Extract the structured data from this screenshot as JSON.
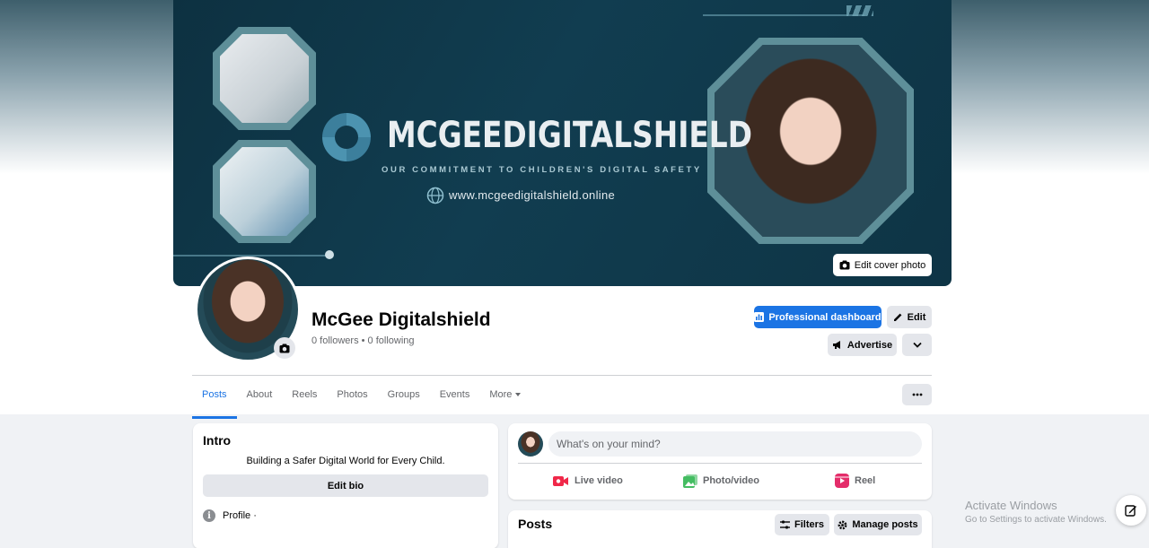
{
  "cover": {
    "brand_name": "MCGEEDIGITALSHIELD",
    "tagline": "OUR COMMITMENT TO CHILDREN'S DIGITAL SAFETY",
    "website": "www.mcgeedigitalshield.online",
    "edit_cover_label": "Edit cover photo"
  },
  "profile": {
    "name": "McGee Digitalshield",
    "followers_line": "0 followers • 0 following"
  },
  "actions": {
    "professional_dashboard": "Professional dashboard",
    "edit": "Edit",
    "advertise": "Advertise"
  },
  "tabs": [
    "Posts",
    "About",
    "Reels",
    "Photos",
    "Groups",
    "Events",
    "More"
  ],
  "intro": {
    "title": "Intro",
    "bio": "Building a Safer Digital World for Every Child.",
    "edit_bio": "Edit bio",
    "profile_label": "Profile ·"
  },
  "composer": {
    "placeholder": "What's on your mind?",
    "live_video": "Live video",
    "photo_video": "Photo/video",
    "reel": "Reel"
  },
  "posts": {
    "title": "Posts",
    "filters": "Filters",
    "manage_posts": "Manage posts"
  },
  "watermark": {
    "line1": "Activate Windows",
    "line2": "Go to Settings to activate Windows."
  },
  "colors": {
    "accent": "#1b74e4",
    "cover_bg": "#113d50"
  }
}
